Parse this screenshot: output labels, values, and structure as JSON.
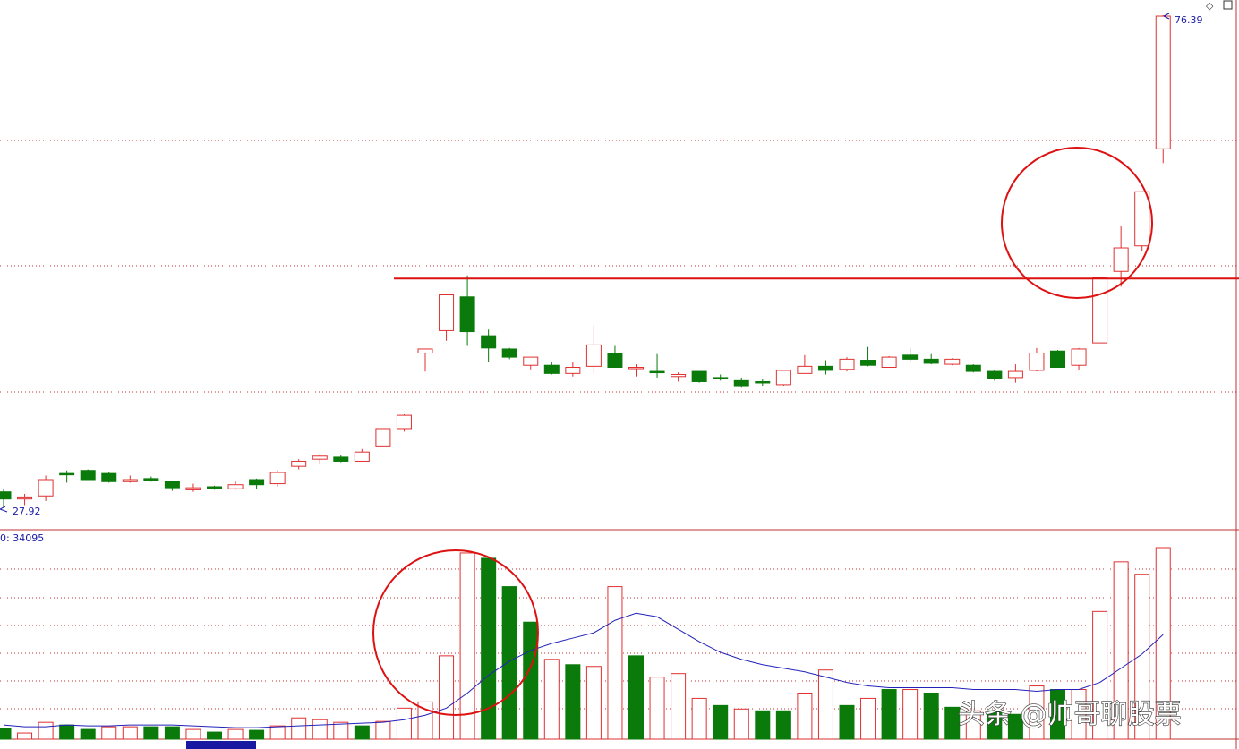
{
  "chart_data": [
    {
      "type": "candlestick",
      "pane": "price",
      "price_range": [
        27.92,
        76.39
      ],
      "high_label": "76.39",
      "low_label": "27.92",
      "resistance_line": 50.6,
      "grid": "dotted-horizontal",
      "candles": [
        {
          "o": 29.7,
          "h": 30.0,
          "l": 28.2,
          "c": 29.0,
          "dir": "down"
        },
        {
          "o": 29.0,
          "h": 29.5,
          "l": 28.4,
          "c": 29.2,
          "dir": "up"
        },
        {
          "o": 29.3,
          "h": 31.3,
          "l": 28.8,
          "c": 30.9,
          "dir": "up"
        },
        {
          "o": 31.5,
          "h": 31.8,
          "l": 30.6,
          "c": 31.4,
          "dir": "down"
        },
        {
          "o": 31.8,
          "h": 31.9,
          "l": 30.9,
          "c": 30.9,
          "dir": "down"
        },
        {
          "o": 31.5,
          "h": 31.6,
          "l": 30.6,
          "c": 30.7,
          "dir": "down"
        },
        {
          "o": 30.7,
          "h": 31.3,
          "l": 30.6,
          "c": 30.9,
          "dir": "up"
        },
        {
          "o": 31.0,
          "h": 31.2,
          "l": 30.7,
          "c": 30.8,
          "dir": "down"
        },
        {
          "o": 30.7,
          "h": 30.8,
          "l": 29.8,
          "c": 30.1,
          "dir": "down"
        },
        {
          "o": 29.9,
          "h": 30.5,
          "l": 29.7,
          "c": 30.1,
          "dir": "up"
        },
        {
          "o": 30.2,
          "h": 30.3,
          "l": 29.9,
          "c": 30.1,
          "dir": "down"
        },
        {
          "o": 30.0,
          "h": 30.8,
          "l": 29.9,
          "c": 30.4,
          "dir": "up"
        },
        {
          "o": 30.4,
          "h": 31.0,
          "l": 30.0,
          "c": 30.9,
          "dir": "down"
        },
        {
          "o": 30.5,
          "h": 31.8,
          "l": 30.2,
          "c": 31.6,
          "dir": "up"
        },
        {
          "o": 32.2,
          "h": 32.9,
          "l": 31.9,
          "c": 32.7,
          "dir": "up"
        },
        {
          "o": 32.9,
          "h": 33.4,
          "l": 32.5,
          "c": 33.2,
          "dir": "up"
        },
        {
          "o": 33.1,
          "h": 33.3,
          "l": 32.6,
          "c": 32.7,
          "dir": "down"
        },
        {
          "o": 32.7,
          "h": 33.9,
          "l": 32.7,
          "c": 33.6,
          "dir": "up"
        },
        {
          "o": 34.2,
          "h": 35.6,
          "l": 34.2,
          "c": 35.9,
          "dir": "up"
        },
        {
          "o": 35.9,
          "h": 37.3,
          "l": 35.6,
          "c": 37.2,
          "dir": "up"
        },
        {
          "o": 43.3,
          "h": 43.7,
          "l": 41.5,
          "c": 43.7,
          "dir": "up"
        },
        {
          "o": 45.5,
          "h": 49.0,
          "l": 44.5,
          "c": 49.0,
          "dir": "up"
        },
        {
          "o": 48.8,
          "h": 50.9,
          "l": 44.0,
          "c": 45.4,
          "dir": "down"
        },
        {
          "o": 45.0,
          "h": 45.6,
          "l": 42.4,
          "c": 43.8,
          "dir": "down"
        },
        {
          "o": 43.7,
          "h": 43.8,
          "l": 42.7,
          "c": 42.9,
          "dir": "down"
        },
        {
          "o": 42.1,
          "h": 42.9,
          "l": 41.7,
          "c": 42.9,
          "dir": "up"
        },
        {
          "o": 42.1,
          "h": 42.4,
          "l": 41.2,
          "c": 41.3,
          "dir": "down"
        },
        {
          "o": 41.3,
          "h": 42.4,
          "l": 41.0,
          "c": 41.9,
          "dir": "up"
        },
        {
          "o": 42.0,
          "h": 46.0,
          "l": 41.3,
          "c": 44.1,
          "dir": "up"
        },
        {
          "o": 43.3,
          "h": 44.0,
          "l": 42.0,
          "c": 41.9,
          "dir": "down"
        },
        {
          "o": 41.9,
          "h": 42.2,
          "l": 41.0,
          "c": 41.9,
          "dir": "up"
        },
        {
          "o": 41.5,
          "h": 43.2,
          "l": 40.9,
          "c": 41.4,
          "dir": "down"
        },
        {
          "o": 41.2,
          "h": 41.4,
          "l": 40.5,
          "c": 41.0,
          "dir": "up"
        },
        {
          "o": 41.5,
          "h": 41.5,
          "l": 40.4,
          "c": 40.5,
          "dir": "down"
        },
        {
          "o": 40.9,
          "h": 41.2,
          "l": 40.6,
          "c": 40.9,
          "dir": "down"
        },
        {
          "o": 40.6,
          "h": 40.9,
          "l": 39.9,
          "c": 40.1,
          "dir": "down"
        },
        {
          "o": 40.5,
          "h": 40.8,
          "l": 40.1,
          "c": 40.5,
          "dir": "down"
        },
        {
          "o": 40.2,
          "h": 41.6,
          "l": 40.1,
          "c": 41.6,
          "dir": "up"
        },
        {
          "o": 41.3,
          "h": 43.1,
          "l": 41.3,
          "c": 42.0,
          "dir": "up"
        },
        {
          "o": 42.0,
          "h": 42.6,
          "l": 41.2,
          "c": 41.6,
          "dir": "down"
        },
        {
          "o": 41.7,
          "h": 42.9,
          "l": 41.5,
          "c": 42.7,
          "dir": "up"
        },
        {
          "o": 42.6,
          "h": 43.9,
          "l": 42.0,
          "c": 42.1,
          "dir": "down"
        },
        {
          "o": 41.9,
          "h": 43.0,
          "l": 41.9,
          "c": 42.9,
          "dir": "up"
        },
        {
          "o": 43.1,
          "h": 43.8,
          "l": 42.5,
          "c": 42.7,
          "dir": "down"
        },
        {
          "o": 42.7,
          "h": 43.2,
          "l": 42.2,
          "c": 42.3,
          "dir": "down"
        },
        {
          "o": 42.2,
          "h": 42.8,
          "l": 42.1,
          "c": 42.7,
          "dir": "up"
        },
        {
          "o": 42.1,
          "h": 42.2,
          "l": 41.4,
          "c": 41.5,
          "dir": "down"
        },
        {
          "o": 41.5,
          "h": 41.6,
          "l": 40.6,
          "c": 40.8,
          "dir": "down"
        },
        {
          "o": 40.9,
          "h": 42.2,
          "l": 40.4,
          "c": 41.5,
          "dir": "up"
        },
        {
          "o": 41.6,
          "h": 43.8,
          "l": 41.5,
          "c": 43.3,
          "dir": "up"
        },
        {
          "o": 43.5,
          "h": 43.6,
          "l": 42.0,
          "c": 41.9,
          "dir": "down"
        },
        {
          "o": 42.1,
          "h": 43.8,
          "l": 41.6,
          "c": 43.7,
          "dir": "up"
        },
        {
          "o": 44.3,
          "h": 50.7,
          "l": 44.3,
          "c": 50.7,
          "dir": "up"
        },
        {
          "o": 51.3,
          "h": 55.8,
          "l": 49.8,
          "c": 53.6,
          "dir": "up"
        },
        {
          "o": 53.8,
          "h": 59.1,
          "l": 53.3,
          "c": 59.1,
          "dir": "up"
        },
        {
          "o": 63.3,
          "h": 76.39,
          "l": 61.9,
          "c": 76.3,
          "dir": "up"
        }
      ]
    },
    {
      "type": "bar",
      "pane": "volume",
      "label": "0: 34095",
      "bars": [
        {
          "v": 0.6,
          "dir": "down"
        },
        {
          "v": 0.35,
          "dir": "up"
        },
        {
          "v": 0.95,
          "dir": "up"
        },
        {
          "v": 0.8,
          "dir": "down"
        },
        {
          "v": 0.55,
          "dir": "down"
        },
        {
          "v": 0.7,
          "dir": "up"
        },
        {
          "v": 0.7,
          "dir": "up"
        },
        {
          "v": 0.7,
          "dir": "down"
        },
        {
          "v": 0.7,
          "dir": "down"
        },
        {
          "v": 0.55,
          "dir": "up"
        },
        {
          "v": 0.4,
          "dir": "down"
        },
        {
          "v": 0.55,
          "dir": "up"
        },
        {
          "v": 0.5,
          "dir": "down"
        },
        {
          "v": 0.75,
          "dir": "up"
        },
        {
          "v": 1.2,
          "dir": "up"
        },
        {
          "v": 1.1,
          "dir": "up"
        },
        {
          "v": 0.95,
          "dir": "up"
        },
        {
          "v": 0.75,
          "dir": "down"
        },
        {
          "v": 1.0,
          "dir": "up"
        },
        {
          "v": 1.75,
          "dir": "up"
        },
        {
          "v": 2.1,
          "dir": "up"
        },
        {
          "v": 4.7,
          "dir": "up"
        },
        {
          "v": 10.5,
          "dir": "up"
        },
        {
          "v": 10.2,
          "dir": "down"
        },
        {
          "v": 8.6,
          "dir": "down"
        },
        {
          "v": 6.6,
          "dir": "down"
        },
        {
          "v": 4.5,
          "dir": "up"
        },
        {
          "v": 4.2,
          "dir": "down"
        },
        {
          "v": 4.1,
          "dir": "up"
        },
        {
          "v": 8.6,
          "dir": "up"
        },
        {
          "v": 4.7,
          "dir": "down"
        },
        {
          "v": 3.5,
          "dir": "up"
        },
        {
          "v": 3.7,
          "dir": "up"
        },
        {
          "v": 2.3,
          "dir": "up"
        },
        {
          "v": 1.9,
          "dir": "down"
        },
        {
          "v": 1.7,
          "dir": "up"
        },
        {
          "v": 1.6,
          "dir": "down"
        },
        {
          "v": 1.6,
          "dir": "down"
        },
        {
          "v": 2.6,
          "dir": "up"
        },
        {
          "v": 3.9,
          "dir": "up"
        },
        {
          "v": 1.9,
          "dir": "down"
        },
        {
          "v": 2.3,
          "dir": "up"
        },
        {
          "v": 2.8,
          "dir": "down"
        },
        {
          "v": 2.8,
          "dir": "up"
        },
        {
          "v": 2.6,
          "dir": "down"
        },
        {
          "v": 1.8,
          "dir": "down"
        },
        {
          "v": 1.6,
          "dir": "up"
        },
        {
          "v": 1.6,
          "dir": "down"
        },
        {
          "v": 1.4,
          "dir": "down"
        },
        {
          "v": 3.0,
          "dir": "up"
        },
        {
          "v": 2.8,
          "dir": "down"
        },
        {
          "v": 2.8,
          "dir": "up"
        },
        {
          "v": 7.2,
          "dir": "up"
        },
        {
          "v": 10.0,
          "dir": "up"
        },
        {
          "v": 9.3,
          "dir": "up"
        },
        {
          "v": 10.8,
          "dir": "up"
        }
      ],
      "ma": [
        0.8,
        0.7,
        0.7,
        0.8,
        0.75,
        0.75,
        0.8,
        0.8,
        0.8,
        0.75,
        0.7,
        0.65,
        0.65,
        0.7,
        0.75,
        0.8,
        0.85,
        0.9,
        0.95,
        1.1,
        1.35,
        1.75,
        2.6,
        3.6,
        4.4,
        5.0,
        5.4,
        5.7,
        6.0,
        6.7,
        7.1,
        6.9,
        6.2,
        5.5,
        4.9,
        4.5,
        4.2,
        4.0,
        3.8,
        3.5,
        3.2,
        3.0,
        2.9,
        2.9,
        2.9,
        2.9,
        2.8,
        2.8,
        2.8,
        2.7,
        2.8,
        2.8,
        3.2,
        4.0,
        4.8,
        5.9
      ]
    }
  ],
  "watermark": "头条 @帅哥聊股票",
  "colors": {
    "up": "#e03030",
    "down": "#0a7a0a",
    "ma": "#2222bb",
    "grid": "#d04040",
    "resistance": "#dd1111",
    "circle": "#dd1111",
    "label": "#1a1aa6"
  }
}
